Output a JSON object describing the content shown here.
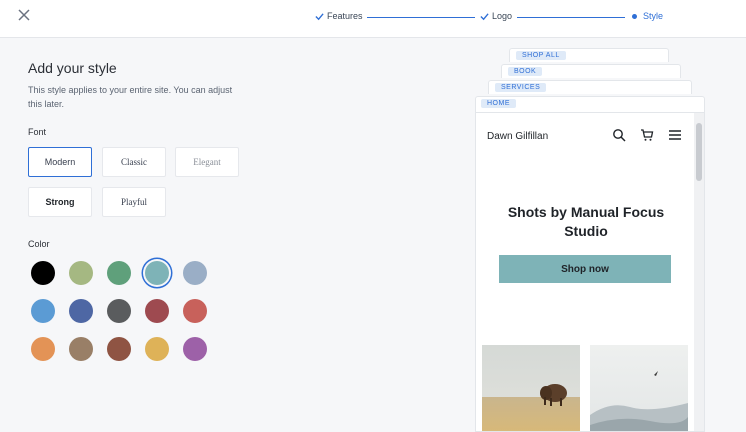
{
  "header": {
    "close_label": "×",
    "steps": [
      {
        "label": "Features",
        "state": "done"
      },
      {
        "label": "Logo",
        "state": "done"
      },
      {
        "label": "Style",
        "state": "active"
      }
    ]
  },
  "panel": {
    "title": "Add your style",
    "description": "This style applies to your entire site. You can adjust this later.",
    "font_label": "Font",
    "fonts": [
      "Modern",
      "Classic",
      "Elegant",
      "Strong",
      "Playful"
    ],
    "selected_font": "Modern",
    "color_label": "Color",
    "colors": [
      "#000000",
      "#a5b882",
      "#5fa07b",
      "#7eb3b7",
      "#9aaec6",
      "#5b9bd4",
      "#4e67a4",
      "#5a5c5e",
      "#9e4a50",
      "#c8615b",
      "#e39356",
      "#997f67",
      "#8f5443",
      "#deb258",
      "#9d61a8"
    ],
    "selected_color": "#7eb3b7"
  },
  "preview": {
    "tabs": [
      "SHOP ALL",
      "BOOK",
      "SERVICES",
      "HOME"
    ],
    "site_name": "Dawn Gilfillan",
    "icons": [
      "search-icon",
      "cart-icon",
      "menu-icon"
    ],
    "hero_title": "Shots by Manual Focus Studio",
    "cta_label": "Shop now",
    "accent": "#7eb3b7"
  }
}
